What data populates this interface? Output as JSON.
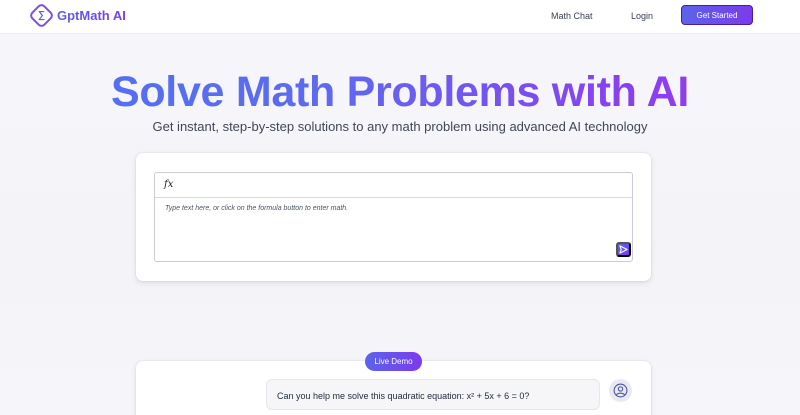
{
  "header": {
    "brand_name": "GptMath AI",
    "logo_icon": "math-logo-icon",
    "nav": {
      "math_chat": "Math Chat",
      "login": "Login",
      "get_started": "Get Started"
    }
  },
  "hero": {
    "title": "Solve Math Problems with AI",
    "subtitle": "Get instant, step-by-step solutions to any math problem using advanced AI technology"
  },
  "editor": {
    "formula_button": "𝑓x",
    "placeholder": "Type text here, or click on the formula button to enter math.",
    "send_icon": "send-icon"
  },
  "demo": {
    "badge": "Live Demo",
    "user_message": "Can you help me solve this quadratic equation: x² + 5x + 6 = 0?",
    "avatar_icon": "user-avatar-icon"
  },
  "colors": {
    "accent_start": "#5b64ea",
    "accent_end": "#7c3aed"
  }
}
